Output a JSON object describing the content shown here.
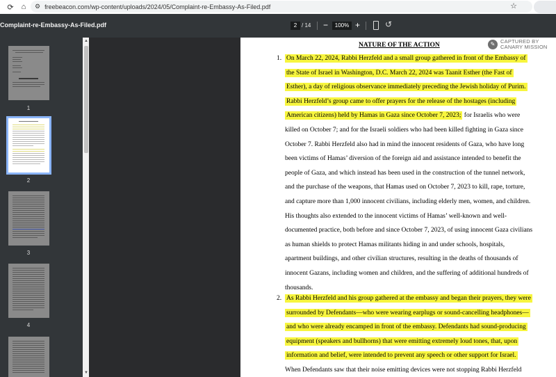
{
  "browser": {
    "url": "freebeacon.com/wp-content/uploads/2024/05/Complaint-re-Embassy-As-Filed.pdf"
  },
  "toolbar": {
    "title": "Complaint-re-Embassy-As-Filed.pdf",
    "current_page": "2",
    "total_pages": "/ 14",
    "zoom_minus": "−",
    "zoom": "100%",
    "zoom_plus": "+"
  },
  "sidebar": {
    "pages": [
      "1",
      "2",
      "3",
      "4"
    ],
    "active_page": "2"
  },
  "document": {
    "heading": "NATURE OF THE ACTION",
    "watermark_line1": "CAPTURED BY",
    "watermark_line2": "CANARY MISSION",
    "para1_number": "1.",
    "para1_lines": [
      {
        "hl": "On March 22, 2024, Rabbi Herzfeld and a small group gathered in front of the Embassy of",
        "rest": ""
      },
      {
        "hl": "the State of Israel in Washington, D.C.  March 22, 2024 was Taanit Esther (the Fast of",
        "rest": ""
      },
      {
        "hl": "Esther), a day of religious observance immediately preceding the Jewish holiday of Purim.",
        "rest": ""
      },
      {
        "hl": "Rabbi Herzfeld’s group came to offer prayers for the release of the hostages (including",
        "rest": ""
      },
      {
        "hl": "American citizens) held by Hamas in Gaza since October 7, 2023;",
        "rest": " for Israelis who were"
      },
      {
        "hl": "",
        "rest": "killed on October 7; and for the Israeli soldiers who had been killed fighting in Gaza since"
      },
      {
        "hl": "",
        "rest": "October 7.  Rabbi Herzfeld also had in mind the innocent residents of Gaza, who have long"
      },
      {
        "hl": "",
        "rest": "been victims of Hamas’ diversion of the foreign aid and assistance intended to benefit the"
      },
      {
        "hl": "",
        "rest": "people of Gaza, and which instead has been used in the construction of the tunnel network,"
      },
      {
        "hl": "",
        "rest": "and the purchase of the weapons, that Hamas used on October 7, 2023 to kill, rape, torture,"
      },
      {
        "hl": "",
        "rest": "and capture more than 1,000 innocent civilians, including elderly men, women, and children."
      },
      {
        "hl": "",
        "rest": "His thoughts also extended to the innocent victims of Hamas’ well-known and well-"
      },
      {
        "hl": "",
        "rest": "documented practice, both before and since October 7, 2023, of using innocent Gaza civilians"
      },
      {
        "hl": "",
        "rest": "as human shields to protect Hamas militants hiding in and under schools, hospitals,"
      },
      {
        "hl": "",
        "rest": "apartment buildings, and other civilian structures, resulting in the deaths of thousands of"
      },
      {
        "hl": "",
        "rest": "innocent Gazans, including women and children, and the suffering of additional hundreds of"
      },
      {
        "hl": "",
        "rest": "thousands."
      }
    ],
    "para2_number": "2.",
    "para2_lines": [
      {
        "hl": "As Rabbi Herzfeld and his group gathered at the embassy and began their prayers, they were",
        "rest": ""
      },
      {
        "hl": "surrounded by Defendants—who were wearing earplugs or sound-cancelling headphones—",
        "rest": ""
      },
      {
        "hl": "and who were already encamped in front of the embassy.  Defendants had sound-producing",
        "rest": ""
      },
      {
        "hl": "equipment (speakers and bullhorns) that were emitting extremely loud tones, that, upon",
        "rest": ""
      },
      {
        "hl": "information and belief, were intended to prevent any speech or other support for Israel.",
        "rest": ""
      },
      {
        "hl": "",
        "rest": "When Defendants saw that their noise emitting devices were not stopping Rabbi Herzfeld"
      }
    ]
  }
}
